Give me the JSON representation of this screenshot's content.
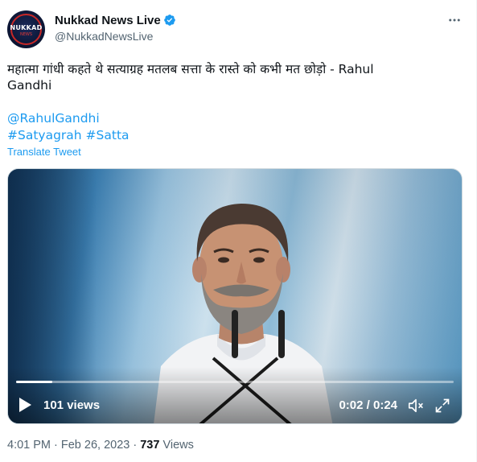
{
  "account": {
    "display_name": "Nukkad News Live",
    "handle": "@NukkadNewsLive",
    "avatar_logo_text": "NUKKAD",
    "avatar_logo_sub": "NEWS",
    "verified_icon": "verified-badge-icon",
    "brand_color": "#1d9bf0"
  },
  "tweet": {
    "text_line1": "महात्मा गांधी कहते थे सत्याग्रह मतलब सत्ता के रास्ते को कभी मत छोड़ो - Rahul",
    "text_line2": "Gandhi",
    "mention": "@RahulGandhi",
    "hashtag1": "#Satyagrah",
    "hashtag2": "#Satta",
    "translate_label": "Translate Tweet"
  },
  "video": {
    "views_label": "101 views",
    "time_label": "0:02 / 0:24",
    "progress_fraction": 0.083,
    "play_icon": "play-icon",
    "mute_icon": "mute-icon",
    "fullscreen_icon": "fullscreen-icon"
  },
  "meta": {
    "timestamp": "4:01 PM · Feb 26, 2023 · ",
    "views_count": "737",
    "views_word": " Views"
  },
  "more_icon": "more-options-icon"
}
